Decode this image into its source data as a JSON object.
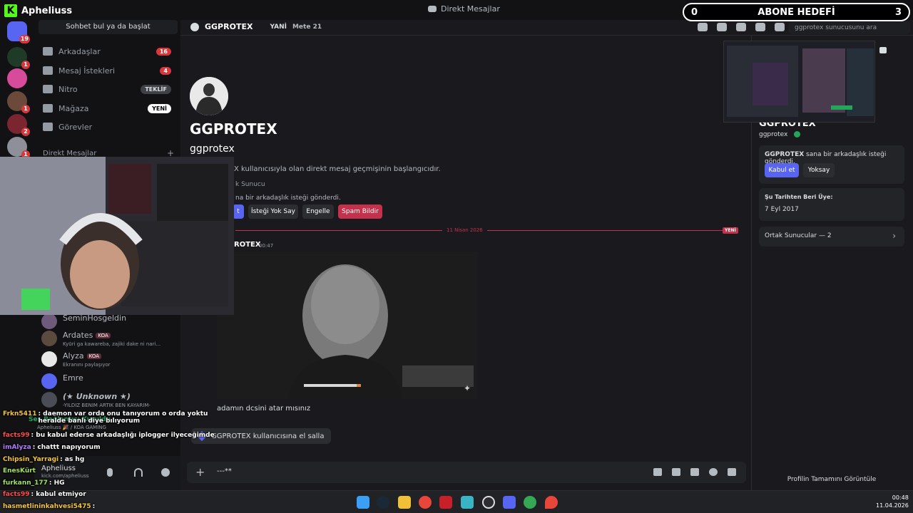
{
  "app": {
    "stream_brand": "Apheliuss",
    "window_title": "Direkt Mesajlar",
    "sub_goal": {
      "current": "0",
      "label": "ABONE HEDEFİ",
      "target": "3"
    }
  },
  "servers": {
    "home_badge": "19",
    "items": [
      {
        "name": "server-green",
        "badge": "1"
      },
      {
        "name": "server-chips",
        "badge": ""
      },
      {
        "name": "server-avatar-1",
        "badge": "1"
      },
      {
        "name": "server-avatar-2",
        "badge": "2"
      },
      {
        "name": "server-avatar-3",
        "badge": "1"
      }
    ]
  },
  "sidebar": {
    "search_placeholder": "Sohbet bul ya da başlat",
    "nav": [
      {
        "label": "Arkadaşlar",
        "count": "16"
      },
      {
        "label": "Mesaj İstekleri",
        "count": "4"
      },
      {
        "label": "Nitro",
        "pill": "TEKLİF"
      },
      {
        "label": "Mağaza",
        "pill": "YENİ"
      },
      {
        "label": "Görevler"
      }
    ],
    "dm_header": "Direkt Mesajlar",
    "dm_list": [
      {
        "name": "SeminHosgeldin",
        "status": ""
      },
      {
        "name": "Ardates",
        "tag": "KOA",
        "status": "Kyūri ga kawareba, zajiki dake ni nari..."
      },
      {
        "name": "Alyza",
        "tag": "KOA",
        "status": "Ekranını paylaşıyor"
      },
      {
        "name": "Emre",
        "status": ""
      },
      {
        "name": "(★ Unknown ★)",
        "status": "-YILDIZ BENIM ARTIK BEN KAYARIM-"
      }
    ]
  },
  "voice_panel": {
    "status": "Ses Bağlantısı Kuruldu",
    "channel": "Apheliuss 🎉 / KOA GAMING",
    "user": "Apheliuss",
    "link": "kick.com/apheliuss"
  },
  "chat_overlay": [
    {
      "user": "Frkn5411",
      "msg": ": daemon var orda onu tanıyorum o orda yoktu heralde banlı diye bılıyorum",
      "color": "#f5c542"
    },
    {
      "user": "facts99",
      "msg": ": bu kabul ederse arkadaşlığı iplogger ilyeceğimde",
      "color": "#ff4d4d"
    },
    {
      "user": "imAlyza",
      "msg": ": chattt napıyorum",
      "color": "#b07cff"
    },
    {
      "user": "Chipsin_Yarragi",
      "msg": ": as hg",
      "color": "#f5c542"
    },
    {
      "user": "EnesKürt",
      "msg": "",
      "color": "#a0e060"
    },
    {
      "user": "furkann_177",
      "msg": ": HG",
      "color": "#a0e060"
    },
    {
      "user": "facts99",
      "msg": ": kabul etmiyor",
      "color": "#ff4d4d"
    },
    {
      "user": "hasmetlininkahvesi5475",
      "msg": ":",
      "color": "#f5c542"
    }
  ],
  "topbar": {
    "name": "GGPROTEX",
    "tab1": "YANİ",
    "tab2": "Mete 21",
    "search": "ggprotex sunucusunu ara"
  },
  "profile": {
    "display_name": "GGPROTEX",
    "username": "ggprotex",
    "intro": "X kullanıcısıyla olan direkt mesaj geçmişinin başlangıcıdır.",
    "mutual": "k Sunucu",
    "friend_req": "na bir arkadaşlık isteği gönderdi.",
    "buttons": {
      "accept": "t",
      "ignore": "İsteği Yok Say",
      "block": "Engelle",
      "spam": "Spam Bildir"
    }
  },
  "divider": {
    "date": "11 Nisan 2026",
    "new": "YENİ"
  },
  "message": {
    "author": "ROTEX",
    "time": "00:47",
    "text": "adamın dcsini atar mısınız"
  },
  "wave": {
    "label": "GGPROTEX kullanıcısına el salla"
  },
  "composer": {
    "value": "---**"
  },
  "right_panel": {
    "name": "GGPROTEX",
    "username": "ggprotex",
    "req_name": "GGPROTEX",
    "req_text": " sana bir arkadaşlık isteği gönderdi.",
    "accept": "Kabul et",
    "ignore": "Yoksay",
    "member_since_label": "Şu Tarihten Beri Üye:",
    "member_since": "7 Eyl 2017",
    "mutual_servers": "Ortak Sunucular — 2",
    "full_profile": "Profilin Tamamını Görüntüle"
  },
  "taskbar": {
    "time": "00:48",
    "date": "11.04.2026"
  },
  "colors": {
    "accent": "#5865f2",
    "danger": "#da373c",
    "spam": "#c4314b",
    "kick": "#53fc18"
  }
}
